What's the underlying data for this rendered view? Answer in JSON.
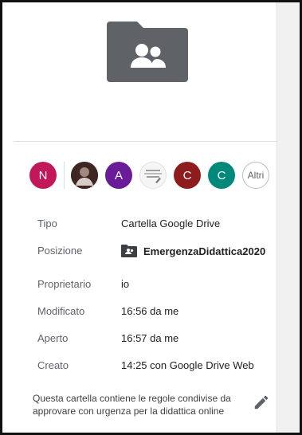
{
  "avatars": [
    {
      "label": "N",
      "color": "#c2185b",
      "type": "letter"
    },
    {
      "label": "",
      "color": "#5d4037",
      "type": "photo",
      "icon": "user-photo-icon"
    },
    {
      "label": "A",
      "color": "#6a1b9a",
      "type": "letter"
    },
    {
      "label": "",
      "color": "#f5f5f5",
      "type": "image",
      "icon": "logo-image-icon"
    },
    {
      "label": "C",
      "color": "#8e1c1c",
      "type": "letter"
    },
    {
      "label": "C",
      "color": "#00897b",
      "type": "letter"
    },
    {
      "label": "Altri",
      "type": "more"
    }
  ],
  "details": [
    {
      "key": "Tipo",
      "value": "Cartella Google Drive"
    },
    {
      "key": "Posizione",
      "value": "EmergenzaDidattica2020",
      "icon": "shared-folder-icon"
    },
    {
      "key": "Proprietario",
      "value": "io"
    },
    {
      "key": "Modificato",
      "value": "16:56 da me"
    },
    {
      "key": "Aperto",
      "value": "16:57 da me"
    },
    {
      "key": "Creato",
      "value": "14:25 con Google Drive Web"
    }
  ],
  "description": "Questa cartella contiene le regole condivise da approvare con urgenza per la didattica online",
  "icons": {
    "preview": "shared-folder-icon",
    "edit": "pencil-icon"
  },
  "colors": {
    "folder": "#5f6368",
    "accent": "#202124"
  }
}
